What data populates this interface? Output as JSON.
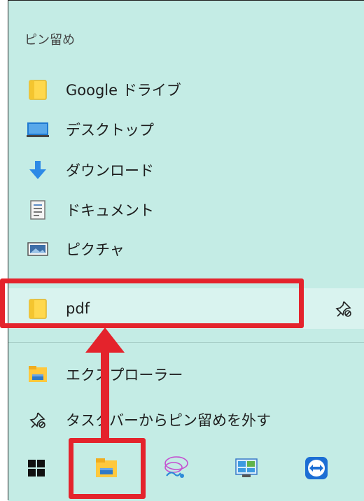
{
  "jumplist": {
    "section_title": "ピン留め",
    "pinned": [
      {
        "label": "Google ドライブ",
        "icon": "folder-icon"
      },
      {
        "label": "デスクトップ",
        "icon": "desktop-icon"
      },
      {
        "label": "ダウンロード",
        "icon": "download-icon"
      },
      {
        "label": "ドキュメント",
        "icon": "document-icon"
      },
      {
        "label": "ピクチャ",
        "icon": "pictures-icon"
      },
      {
        "label": "pdf",
        "icon": "folder-icon",
        "highlighted": true
      }
    ],
    "actions": [
      {
        "label": "エクスプローラー",
        "icon": "file-explorer-icon"
      },
      {
        "label": "タスクバーからピン留めを外す",
        "icon": "unpin-icon"
      }
    ]
  },
  "taskbar": {
    "buttons": [
      {
        "name": "start",
        "icon": "windows-start-icon"
      },
      {
        "name": "file-explorer",
        "icon": "file-explorer-icon",
        "highlighted": true
      },
      {
        "name": "paint-app",
        "icon": "paint-app-icon"
      },
      {
        "name": "control-panel",
        "icon": "control-panel-icon"
      },
      {
        "name": "teamviewer",
        "icon": "teamviewer-icon"
      }
    ]
  },
  "colors": {
    "menu_bg": "#c4ece5",
    "highlight_bg": "#d9f3ef",
    "annotation_red": "#e4232c",
    "folder_yellow": "#ffd84d"
  }
}
